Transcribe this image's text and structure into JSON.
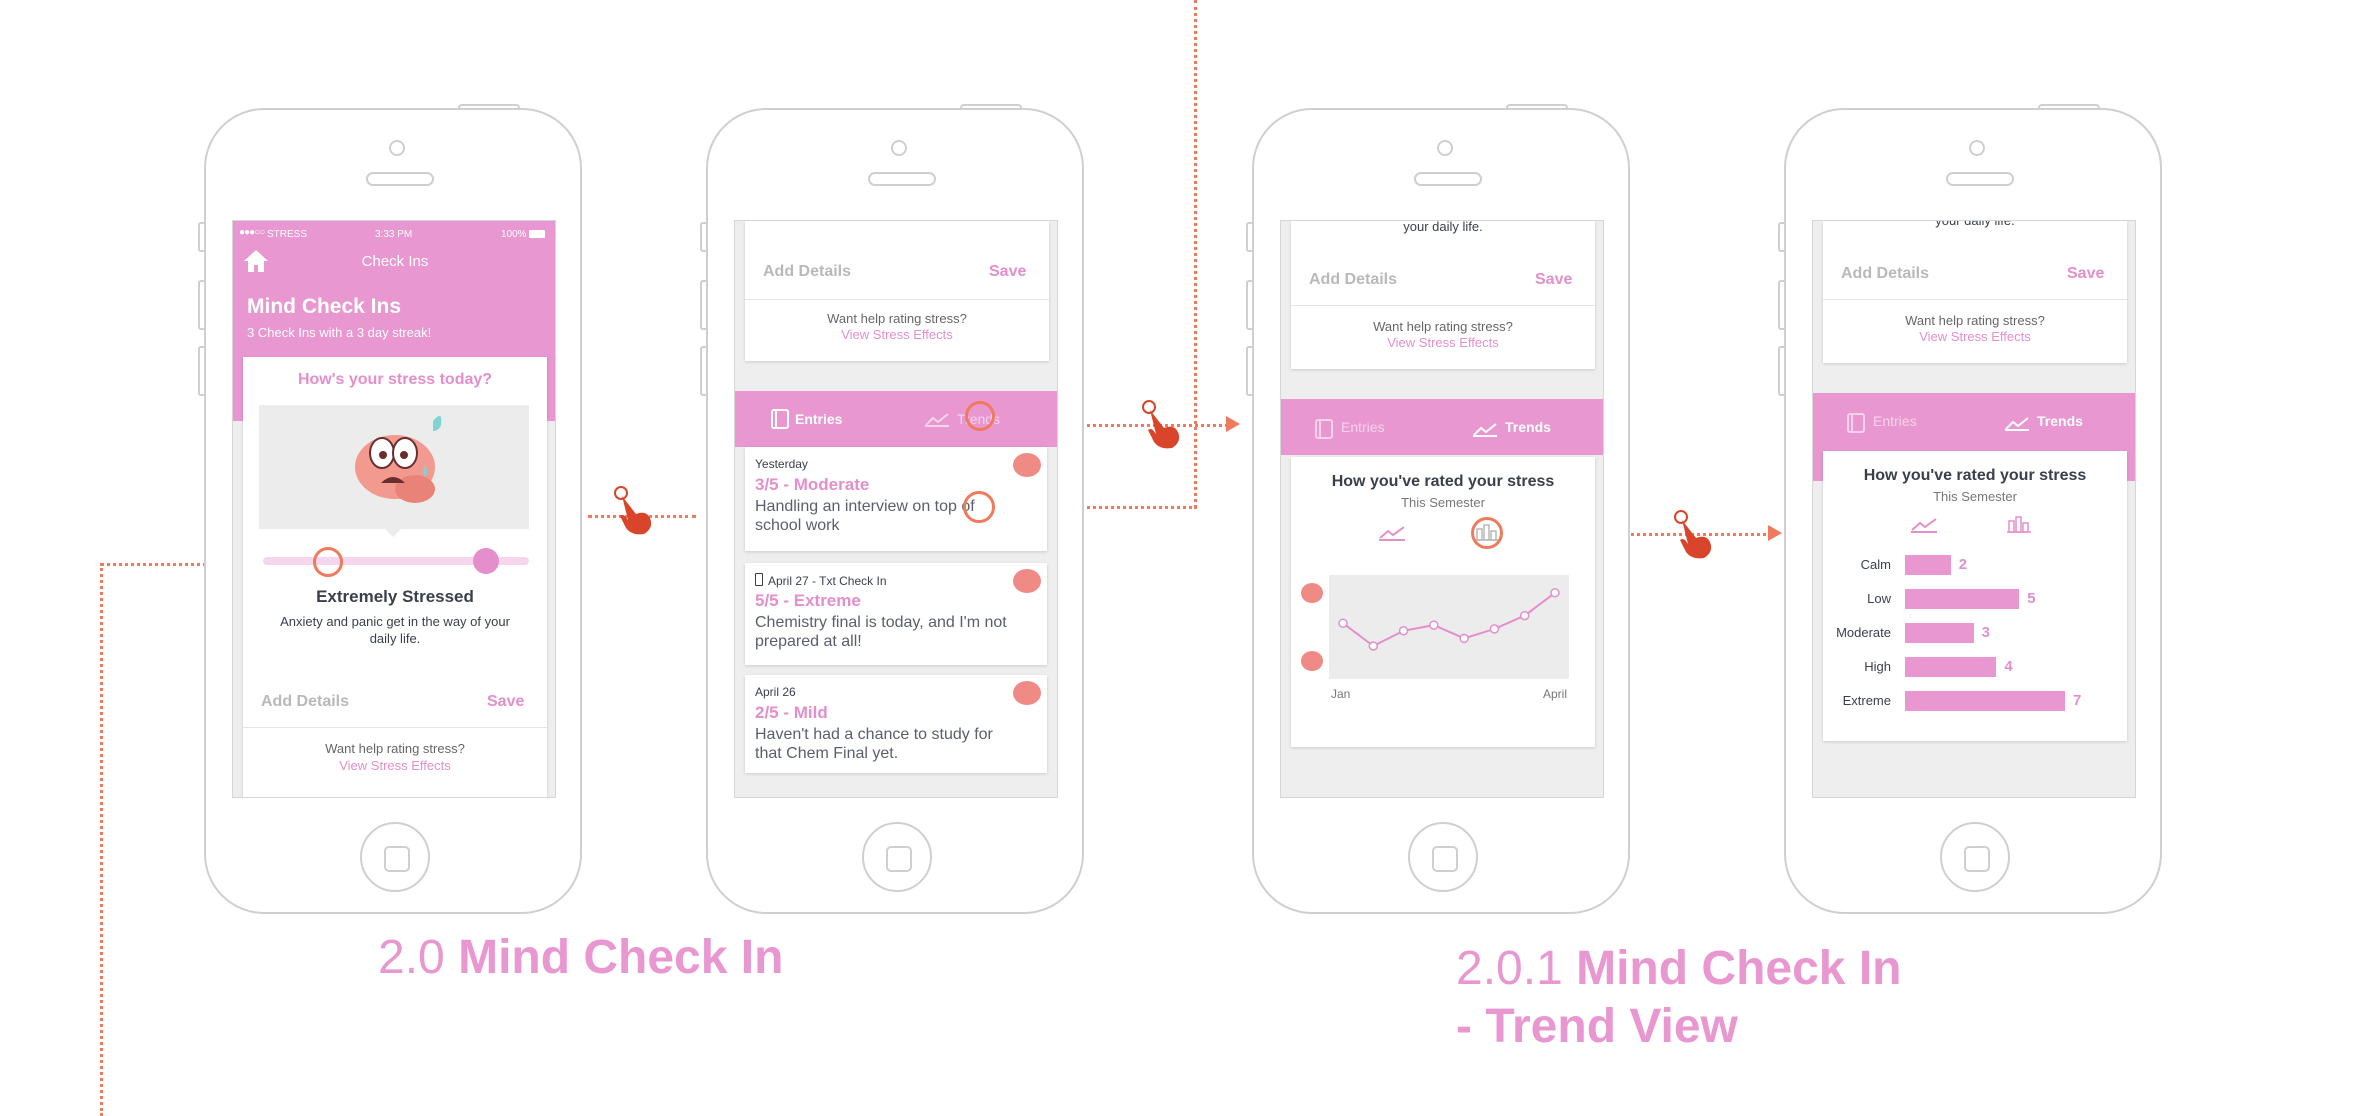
{
  "colors": {
    "accent": "#e897d0",
    "arrow": "#f07a5c",
    "text": "#3a3f4b"
  },
  "status_bar": {
    "carrier": "STRESS",
    "time": "3:33 PM",
    "battery": "100%"
  },
  "screen1": {
    "nav_title": "Check Ins",
    "title": "Mind Check Ins",
    "subtitle": "3 Check Ins with a 3 day streak!",
    "question": "How's your stress today?",
    "slider_value_fraction": 0.85,
    "level_title": "Extremely Stressed",
    "level_desc": "Anxiety and panic get in the way of your daily life.",
    "add_details": "Add Details",
    "save": "Save",
    "help": "Want help rating stress?",
    "help_link": "View Stress Effects"
  },
  "screen2": {
    "add_details": "Add Details",
    "save": "Save",
    "help": "Want help rating stress?",
    "help_link": "View Stress Effects",
    "tab_entries": "Entries",
    "tab_trends": "Trends",
    "entries": [
      {
        "date": "Yesterday",
        "rating": "3/5 - Moderate",
        "desc": "Handling an interview on top of school work"
      },
      {
        "date": "April 27 - Txt Check In",
        "rating": "5/5 - Extreme",
        "desc": "Chemistry final is today, and I'm not prepared at all!"
      },
      {
        "date": "April 26",
        "rating": "2/5 - Mild",
        "desc": "Haven't had a chance to study for that Chem Final yet."
      }
    ]
  },
  "screen3": {
    "top_text": "your daily life.",
    "add_details": "Add Details",
    "save": "Save",
    "help": "Want help rating stress?",
    "help_link": "View Stress Effects",
    "tab_entries": "Entries",
    "tab_trends": "Trends",
    "card_title": "How you've rated your stress",
    "card_subtitle": "This Semester",
    "x_start": "Jan",
    "x_end": "April"
  },
  "screen4": {
    "top_text": "your daily life.",
    "add_details": "Add Details",
    "save": "Save",
    "help": "Want help rating stress?",
    "help_link": "View Stress Effects",
    "tab_entries": "Entries",
    "tab_trends": "Trends",
    "card_title": "How you've rated your stress",
    "card_subtitle": "This Semester"
  },
  "chart_data": [
    {
      "type": "line",
      "x": [
        1,
        2,
        3,
        4,
        5,
        6,
        7,
        8
      ],
      "values": [
        3.2,
        2.0,
        2.8,
        3.1,
        2.4,
        2.9,
        3.6,
        4.8
      ],
      "xlabel_start": "Jan",
      "xlabel_end": "April"
    },
    {
      "type": "bar",
      "categories": [
        "Calm",
        "Low",
        "Moderate",
        "High",
        "Extreme"
      ],
      "values": [
        2,
        5,
        3,
        4,
        7
      ]
    }
  ],
  "captions": {
    "c1_num": "2.0",
    "c1_title": "Mind Check In",
    "c2_num": "2.0.1",
    "c2_title": "Mind Check In",
    "c2_line2": "- Trend View"
  }
}
